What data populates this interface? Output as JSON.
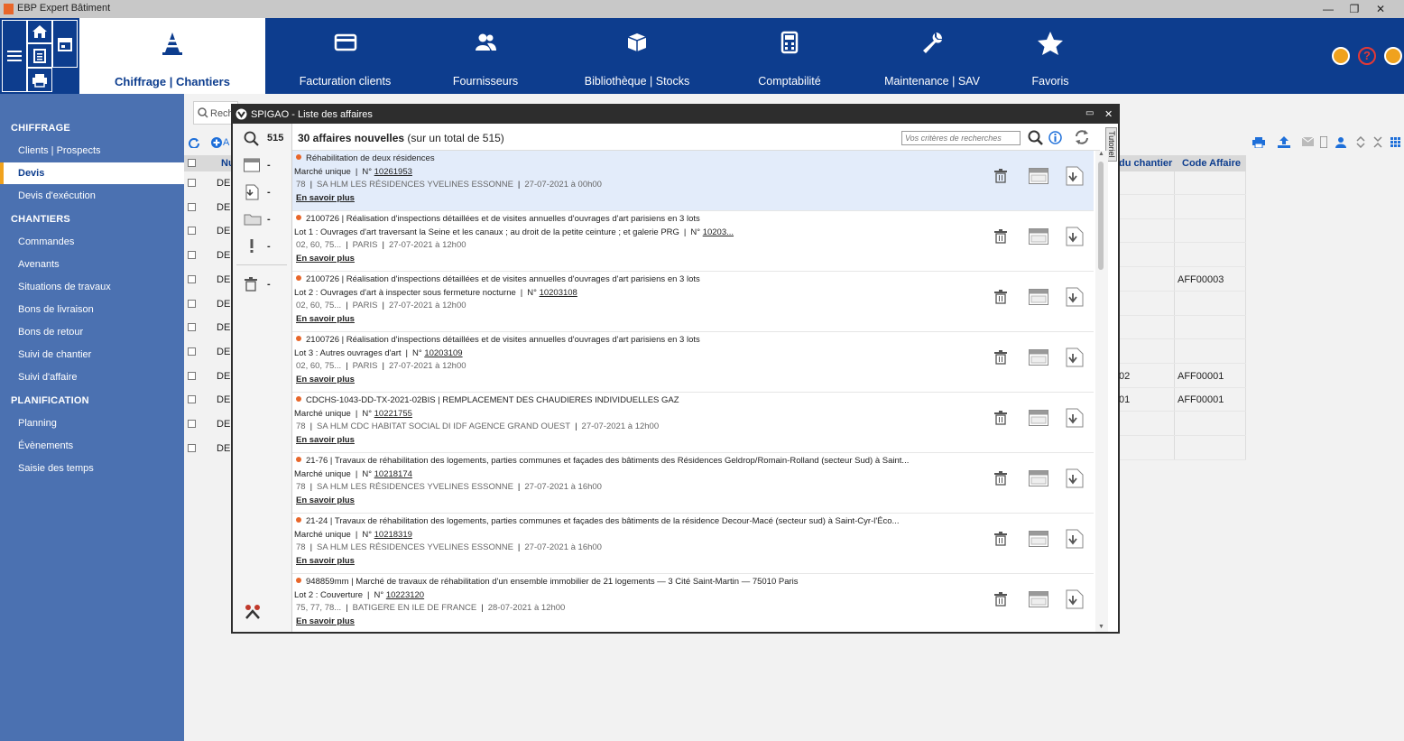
{
  "window": {
    "title": "EBP Expert Bâtiment",
    "minimize": "—",
    "restore": "❐",
    "close": "✕"
  },
  "topnav": {
    "tabs": [
      {
        "label": "Chiffrage | Chantiers",
        "icon": "cone-icon",
        "active": true
      },
      {
        "label": "Facturation clients",
        "icon": "card-icon"
      },
      {
        "label": "Fournisseurs",
        "icon": "users-icon"
      },
      {
        "label": "Bibliothèque | Stocks",
        "icon": "box-icon"
      },
      {
        "label": "Comptabilité",
        "icon": "calculator-icon"
      },
      {
        "label": "Maintenance | SAV",
        "icon": "wrench-icon"
      },
      {
        "label": "Favoris",
        "icon": "star-icon"
      }
    ]
  },
  "sidebar": {
    "sections": [
      {
        "title": "CHIFFRAGE",
        "items": [
          "Clients | Prospects",
          "Devis",
          "Devis d'exécution"
        ]
      },
      {
        "title": "CHANTIERS",
        "items": [
          "Commandes",
          "Avenants",
          "Situations de travaux",
          "Bons de livraison",
          "Bons de retour",
          "Suivi de chantier",
          "Suivi d'affaire"
        ]
      },
      {
        "title": "PLANIFICATION",
        "items": [
          "Planning",
          "Évènements",
          "Saisie des temps"
        ]
      }
    ],
    "active": "Devis"
  },
  "background": {
    "search_placeholder": "Rech",
    "add_label": "A",
    "col_num": "Nu",
    "col_chantier": "du chantier",
    "col_code": "Code Affaire",
    "row_prefix": "DE",
    "code_rows": [
      "",
      "",
      "",
      "",
      "AFF00003",
      "",
      "",
      "",
      "AFF00001",
      "AFF00001",
      "",
      ""
    ],
    "chantier_rows": [
      "",
      "",
      "",
      "",
      "",
      "",
      "",
      "",
      "02",
      "01",
      "",
      ""
    ]
  },
  "dialog": {
    "title": "SPIGAO - Liste des affaires",
    "minimize": "▭",
    "close": "✕",
    "header_bold": "30 affaires nouvelles",
    "header_rest": "(sur un total de 515)",
    "search_placeholder": "Vos critères de recherches",
    "tutorial": "Tutoriel",
    "left_counts": [
      "515",
      "-",
      "-",
      "-",
      "-",
      "-"
    ],
    "more_label": "En savoir plus",
    "affaires": [
      {
        "title": "Réhabilitation de deux résidences",
        "lot": "Marché unique",
        "num": "10261953",
        "dept": "78",
        "org": "SA HLM LES RÉSIDENCES YVELINES ESSONNE",
        "date": "27-07-2021 à 00h00",
        "selected": true
      },
      {
        "title": "2100726 | Réalisation d'inspections détaillées et de visites annuelles d'ouvrages d'art parisiens en 3 lots",
        "lot": "Lot 1 : Ouvrages d'art traversant la Seine et les canaux ; au droit de la petite ceinture ; et galerie PRG",
        "num": "10203...",
        "dept": "02, 60, 75...",
        "org": "PARIS",
        "date": "27-07-2021 à 12h00"
      },
      {
        "title": "2100726 | Réalisation d'inspections détaillées et de visites annuelles d'ouvrages d'art parisiens en 3 lots",
        "lot": "Lot 2 : Ouvrages d'art à inspecter sous fermeture nocturne",
        "num": "10203108",
        "dept": "02, 60, 75...",
        "org": "PARIS",
        "date": "27-07-2021 à 12h00"
      },
      {
        "title": "2100726 | Réalisation d'inspections détaillées et de visites annuelles d'ouvrages d'art parisiens en 3 lots",
        "lot": "Lot 3 : Autres ouvrages d'art",
        "num": "10203109",
        "dept": "02, 60, 75...",
        "org": "PARIS",
        "date": "27-07-2021 à 12h00"
      },
      {
        "title": "CDCHS-1043-DD-TX-2021-02BIS | REMPLACEMENT DES CHAUDIERES INDIVIDUELLES GAZ",
        "lot": "Marché unique",
        "num": "10221755",
        "dept": "78",
        "org": "SA HLM CDC HABITAT SOCIAL DI IDF AGENCE GRAND OUEST",
        "date": "27-07-2021 à 12h00"
      },
      {
        "title": "21-76 | Travaux de réhabilitation des logements, parties communes et façades des bâtiments des Résidences Geldrop/Romain-Rolland (secteur Sud) à Saint...",
        "lot": "Marché unique",
        "num": "10218174",
        "dept": "78",
        "org": "SA HLM LES RÉSIDENCES YVELINES ESSONNE",
        "date": "27-07-2021 à 16h00"
      },
      {
        "title": "21-24 | Travaux de réhabilitation des logements, parties communes et façades des bâtiments de la résidence Decour-Macé (secteur sud) à Saint-Cyr-l'Éco...",
        "lot": "Marché unique",
        "num": "10218319",
        "dept": "78",
        "org": "SA HLM LES RÉSIDENCES YVELINES ESSONNE",
        "date": "27-07-2021 à 16h00"
      },
      {
        "title": "948859mm | Marché de travaux de réhabilitation d'un ensemble immobilier de 21 logements — 3 Cité Saint-Martin — 75010 Paris",
        "lot": "Lot 2 : Couverture",
        "num": "10223120",
        "dept": "75, 77, 78...",
        "org": "BATIGERE EN ILE DE FRANCE",
        "date": "28-07-2021 à 12h00"
      }
    ]
  }
}
